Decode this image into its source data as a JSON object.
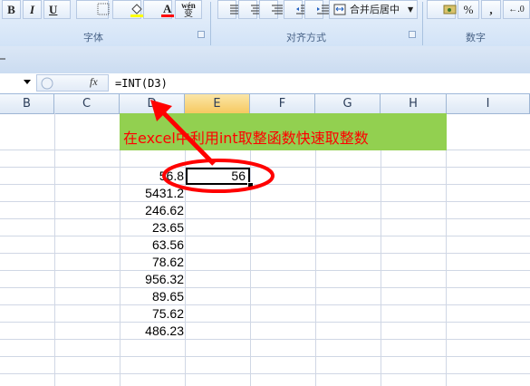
{
  "ribbon": {
    "bold_label": "B",
    "italic_label": "I",
    "underline_label": "U",
    "phonetic_label": "wén",
    "phonetic_sub": "变",
    "font_group_label": "字体",
    "align_group_label": "对齐方式",
    "merge_center_label": "合并后居中",
    "number_group_label": "数字",
    "percent_label": "%",
    "comma_label": ",",
    "decimal_label": "←.0",
    "fill_color": "#ffff00",
    "font_color": "#ff0000"
  },
  "formula_bar": {
    "fx_label": "fx",
    "formula": "=INT(D3)"
  },
  "sheet": {
    "columns": [
      "B",
      "C",
      "D",
      "E",
      "F",
      "G",
      "H",
      "I"
    ],
    "active_column": "E",
    "banner_text": "在excel中利用int取整函数快速取整数",
    "banner_color": "#92d050",
    "banner_text_color": "#ff0000",
    "column_d_values": [
      "56.8",
      "5431.2",
      "246.62",
      "23.65",
      "63.56",
      "78.62",
      "956.32",
      "89.65",
      "75.62",
      "486.23"
    ],
    "e3_value": "56"
  },
  "annotation": {
    "color": "#ff0000"
  }
}
